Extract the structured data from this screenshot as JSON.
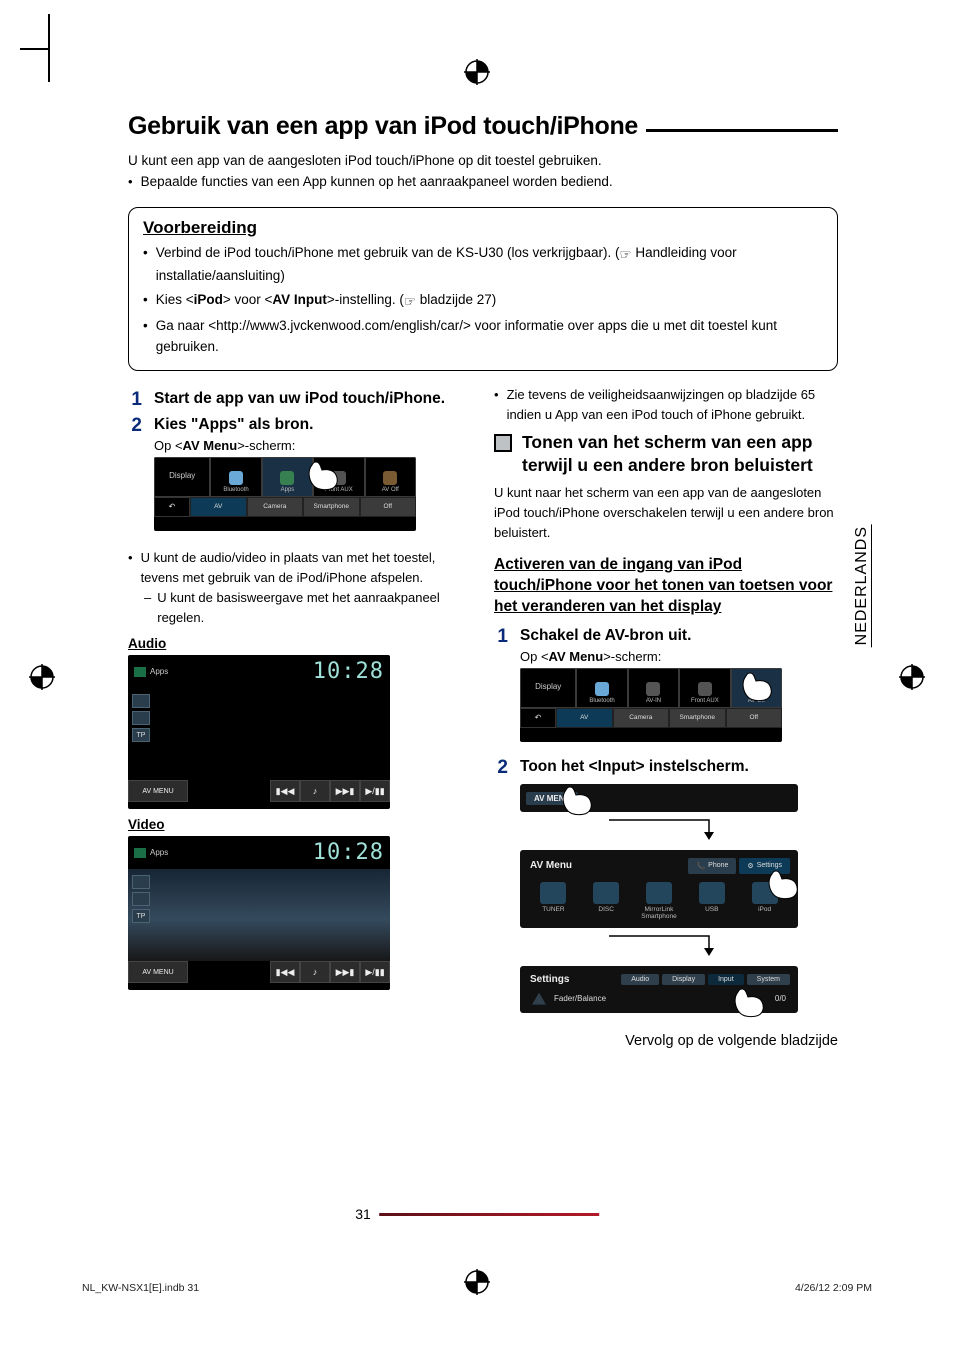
{
  "language_tab": "NEDERLANDS",
  "heading": "Gebruik van een app van iPod touch/iPhone",
  "intro_line": "U kunt een app van de aangesloten iPod touch/iPhone op dit toestel gebruiken.",
  "intro_bullet": "Bepaalde functies van een App kunnen op het aanraakpaneel worden bediend.",
  "prep": {
    "title": "Voorbereiding",
    "b1a": "Verbind de iPod touch/iPhone met gebruik van de KS-U30 (los verkrijgbaar). (",
    "b1b": " Handleiding voor installatie/aansluiting)",
    "b2a": "Kies <",
    "b2b": "iPod",
    "b2c": "> voor <",
    "b2d": "AV Input",
    "b2e": ">-instelling. (",
    "b2f": " bladzijde 27)",
    "b3": "Ga naar <http://www3.jvckenwood.com/english/car/> voor informatie over apps die u met dit toestel kunt gebruiken."
  },
  "left": {
    "step1": "Start de app van uw iPod touch/iPhone.",
    "step2_title": "Kies \"Apps\" als bron.",
    "step2_sub_a": "Op <",
    "step2_sub_b": "AV Menu",
    "step2_sub_c": ">-scherm:",
    "menu_fig": {
      "display": "Display",
      "cells": [
        "Bluetooth",
        "Apps",
        "Front AUX",
        "AV Off"
      ],
      "tabs": [
        "AV",
        "Camera",
        "Smartphone",
        "Off"
      ]
    },
    "note1": "U kunt de audio/video in plaats van met het toestel, tevens met gebruik van de iPod/iPhone afspelen.",
    "note1_sub": "U kunt de basisweergave met het aanraakpaneel regelen.",
    "audio_label": "Audio",
    "video_label": "Video",
    "app_fig": {
      "src": "Apps",
      "clock": "10:28",
      "menu_btn": "AV MENU",
      "tp": "TP"
    }
  },
  "right": {
    "bullet": "Zie tevens de veiligheidsaanwijzingen op bladzijde 65 indien u App van een iPod touch of iPhone gebruikt.",
    "h2": "Tonen van het scherm van een app terwijl u een andere bron beluistert",
    "para": "U kunt naar het scherm van een app van de aangesloten iPod touch/iPhone overschakelen terwijl u een andere bron beluistert.",
    "h3": "Activeren van de ingang van iPod touch/iPhone voor het tonen van toetsen voor het veranderen van het display",
    "step1_title": "Schakel de AV-bron uit.",
    "step1_sub_a": "Op <",
    "step1_sub_b": "AV Menu",
    "step1_sub_c": ">-scherm:",
    "menu_fig": {
      "display": "Display",
      "cells": [
        "Bluetooth",
        "AV-IN",
        "Front AUX",
        "AV Off"
      ],
      "tabs": [
        "AV",
        "Camera",
        "Smartphone",
        "Off"
      ]
    },
    "step2_title": "Toon het <Input> instelscherm.",
    "avmenu": {
      "topbtn": "AV MENU",
      "title": "AV Menu",
      "tabs": [
        "Phone",
        "Settings"
      ],
      "items": [
        "TUNER",
        "DISC",
        "MirrorLink Smartphone",
        "USB",
        "iPod"
      ],
      "settings_title": "Settings",
      "settings_tabs": [
        "Audio",
        "Display",
        "Input",
        "System"
      ],
      "fader_label": "Fader/Balance",
      "fader_value": "0/0"
    },
    "continue": "Vervolg op de volgende bladzijde"
  },
  "page_number": "31",
  "footer_left": "NL_KW-NSX1[E].indb   31",
  "footer_right": "4/26/12   2:09 PM"
}
